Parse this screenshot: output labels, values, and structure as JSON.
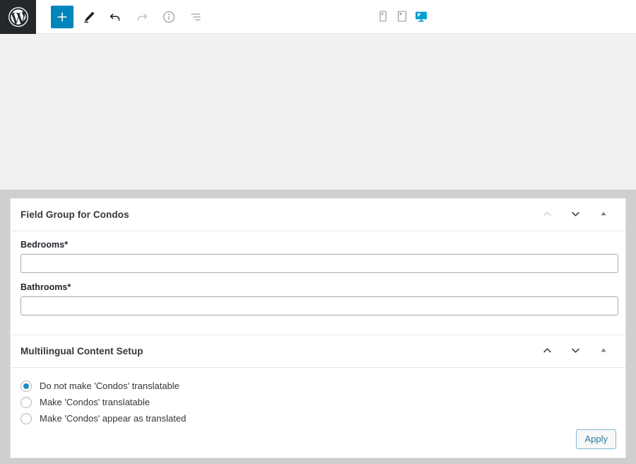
{
  "toolbar": {
    "logo": {
      "name": "WordPress",
      "icon": "wordpress-logo-icon"
    },
    "left_buttons": [
      {
        "name": "add-block-button",
        "icon": "plus-icon",
        "label": "Add block",
        "state": "primary"
      },
      {
        "name": "tools-button",
        "icon": "pencil-icon",
        "label": "Tools",
        "state": "active"
      },
      {
        "name": "undo-button",
        "icon": "undo-arrow-icon",
        "label": "Undo",
        "state": "enabled"
      },
      {
        "name": "redo-button",
        "icon": "redo-arrow-icon",
        "label": "Redo",
        "state": "disabled"
      },
      {
        "name": "details-button",
        "icon": "info-circle-icon",
        "label": "Details",
        "state": "enabled"
      },
      {
        "name": "list-view-button",
        "icon": "list-view-icon",
        "label": "List view",
        "state": "enabled"
      }
    ],
    "device_buttons": [
      {
        "name": "preview-mobile-button",
        "icon": "mobile-device-icon",
        "label": "Mobile",
        "selected": false
      },
      {
        "name": "preview-tablet-button",
        "icon": "tablet-device-icon",
        "label": "Tablet",
        "selected": false
      },
      {
        "name": "preview-desktop-button",
        "icon": "desktop-device-icon",
        "label": "Desktop",
        "selected": true
      }
    ]
  },
  "colors": {
    "accent_blue": "#0085ba",
    "device_active": "#00a0d2",
    "radio_selected": "#1e8cbe",
    "apply_border": "#7eb8d3",
    "apply_text": "#2b7aa0",
    "logo_background": "#23282d",
    "canvas_background": "#f1f1f1",
    "metabox_background": "#cfcfcf"
  },
  "field_group": {
    "title": "Field Group for Condos",
    "controls": {
      "collapse_up": {
        "name": "move-up-button",
        "icon": "chevron-up-icon",
        "state": "disabled"
      },
      "collapse_down": {
        "name": "move-down-button",
        "icon": "chevron-down-icon",
        "state": "enabled"
      },
      "toggle": {
        "name": "toggle-panel-button",
        "icon": "triangle-up-icon",
        "state": "enabled"
      }
    },
    "fields": [
      {
        "label": "Bedrooms*",
        "value": "",
        "placeholder": "",
        "name": "bedrooms-field"
      },
      {
        "label": "Bathrooms*",
        "value": "",
        "placeholder": "",
        "name": "bathrooms-field"
      }
    ]
  },
  "multilingual": {
    "title": "Multilingual Content Setup",
    "controls": {
      "collapse_up": {
        "name": "move-up-button",
        "icon": "chevron-up-icon",
        "state": "enabled"
      },
      "collapse_down": {
        "name": "move-down-button",
        "icon": "chevron-down-icon",
        "state": "enabled"
      },
      "toggle": {
        "name": "toggle-panel-button",
        "icon": "triangle-up-icon",
        "state": "enabled"
      }
    },
    "options": [
      {
        "label": "Do not make 'Condos' translatable",
        "selected": true
      },
      {
        "label": "Make 'Condos' translatable",
        "selected": false
      },
      {
        "label": "Make 'Condos' appear as translated",
        "selected": false
      }
    ],
    "apply_label": "Apply"
  }
}
